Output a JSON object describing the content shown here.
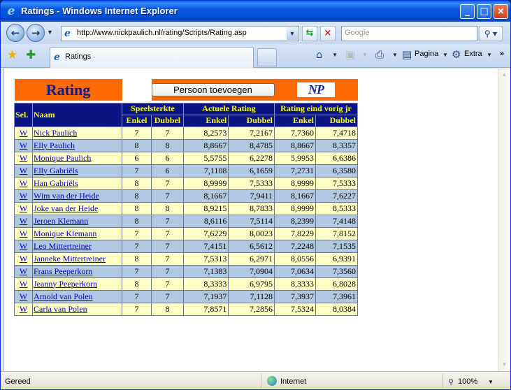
{
  "window": {
    "title": "Ratings - Windows Internet Explorer"
  },
  "addressbar": {
    "url": "http://www.nickpaulich.nl/rating/Scripts/Rating.asp",
    "search_placeholder": "Google"
  },
  "tabs": {
    "active_label": "Ratings"
  },
  "commandbar": {
    "page_label": "Pagina",
    "extra_label": "Extra"
  },
  "statusbar": {
    "status": "Gereed",
    "zone": "Internet",
    "zoom": "100%"
  },
  "page": {
    "title": "Rating",
    "add_button": "Persoon toevoegen",
    "logo_text": "NP",
    "headers": {
      "sel": "Sel.",
      "naam": "Naam",
      "speelsterkte": "Speelsterkte",
      "actuele": "Actuele Rating",
      "vorig": "Rating eind vorig jr",
      "enkel": "Enkel",
      "dubbel": "Dubbel"
    },
    "rows": [
      {
        "sel": "W",
        "naam": "Nick Paulich",
        "ss_enkel": "7",
        "ss_dubbel": "7",
        "ar_enkel": "8,2573",
        "ar_dubbel": "7,2167",
        "vj_enkel": "7,7360",
        "vj_dubbel": "7,4718"
      },
      {
        "sel": "W",
        "naam": "Elly Paulich",
        "ss_enkel": "8",
        "ss_dubbel": "8",
        "ar_enkel": "8,8667",
        "ar_dubbel": "8,4785",
        "vj_enkel": "8,8667",
        "vj_dubbel": "8,3357"
      },
      {
        "sel": "W",
        "naam": "Monique Paulich",
        "ss_enkel": "6",
        "ss_dubbel": "6",
        "ar_enkel": "5,5755",
        "ar_dubbel": "6,2278",
        "vj_enkel": "5,9953",
        "vj_dubbel": "6,6386"
      },
      {
        "sel": "W",
        "naam": "Elly Gabriëls",
        "ss_enkel": "7",
        "ss_dubbel": "6",
        "ar_enkel": "7,1108",
        "ar_dubbel": "6,1659",
        "vj_enkel": "7,2731",
        "vj_dubbel": "6,3580"
      },
      {
        "sel": "W",
        "naam": "Han Gabriëls",
        "ss_enkel": "8",
        "ss_dubbel": "7",
        "ar_enkel": "8,9999",
        "ar_dubbel": "7,5333",
        "vj_enkel": "8,9999",
        "vj_dubbel": "7,5333"
      },
      {
        "sel": "W",
        "naam": "Wim van der Heide",
        "ss_enkel": "8",
        "ss_dubbel": "7",
        "ar_enkel": "8,1667",
        "ar_dubbel": "7,9411",
        "vj_enkel": "8,1667",
        "vj_dubbel": "7,6227"
      },
      {
        "sel": "W",
        "naam": "Joke van der Heide",
        "ss_enkel": "8",
        "ss_dubbel": "8",
        "ar_enkel": "8,9215",
        "ar_dubbel": "8,7833",
        "vj_enkel": "8,9999",
        "vj_dubbel": "8,5333"
      },
      {
        "sel": "W",
        "naam": "Jeroen Klemann",
        "ss_enkel": "8",
        "ss_dubbel": "7",
        "ar_enkel": "8,6116",
        "ar_dubbel": "7,5114",
        "vj_enkel": "8,2399",
        "vj_dubbel": "7,4148"
      },
      {
        "sel": "W",
        "naam": "Monique Klemann",
        "ss_enkel": "7",
        "ss_dubbel": "7",
        "ar_enkel": "7,6229",
        "ar_dubbel": "8,0023",
        "vj_enkel": "7,8229",
        "vj_dubbel": "7,8152"
      },
      {
        "sel": "W",
        "naam": "Leo Mittertreiner",
        "ss_enkel": "7",
        "ss_dubbel": "7",
        "ar_enkel": "7,4151",
        "ar_dubbel": "6,5612",
        "vj_enkel": "7,2248",
        "vj_dubbel": "7,1535"
      },
      {
        "sel": "W",
        "naam": "Janneke Mittertreiner",
        "ss_enkel": "8",
        "ss_dubbel": "7",
        "ar_enkel": "7,5313",
        "ar_dubbel": "6,2971",
        "vj_enkel": "8,0556",
        "vj_dubbel": "6,9391"
      },
      {
        "sel": "W",
        "naam": "Frans Peeperkorn",
        "ss_enkel": "7",
        "ss_dubbel": "7",
        "ar_enkel": "7,1383",
        "ar_dubbel": "7,0904",
        "vj_enkel": "7,0634",
        "vj_dubbel": "7,3560"
      },
      {
        "sel": "W",
        "naam": "Jeanny Peeperkorn",
        "ss_enkel": "8",
        "ss_dubbel": "7",
        "ar_enkel": "8,3333",
        "ar_dubbel": "6,9795",
        "vj_enkel": "8,3333",
        "vj_dubbel": "6,8028"
      },
      {
        "sel": "W",
        "naam": "Arnold van Polen",
        "ss_enkel": "7",
        "ss_dubbel": "7",
        "ar_enkel": "7,1937",
        "ar_dubbel": "7,1128",
        "vj_enkel": "7,3937",
        "vj_dubbel": "7,3961"
      },
      {
        "sel": "W",
        "naam": "Carla van Polen",
        "ss_enkel": "7",
        "ss_dubbel": "8",
        "ar_enkel": "7,8571",
        "ar_dubbel": "7,2856",
        "vj_enkel": "7,5324",
        "vj_dubbel": "8,0384"
      }
    ]
  },
  "colors": {
    "header_orange": "#ff6a00",
    "header_navy": "#0a1483",
    "header_text_yellow": "#ffff00",
    "row_yellow": "#ffffc6",
    "row_blue": "#b0c8e0"
  }
}
